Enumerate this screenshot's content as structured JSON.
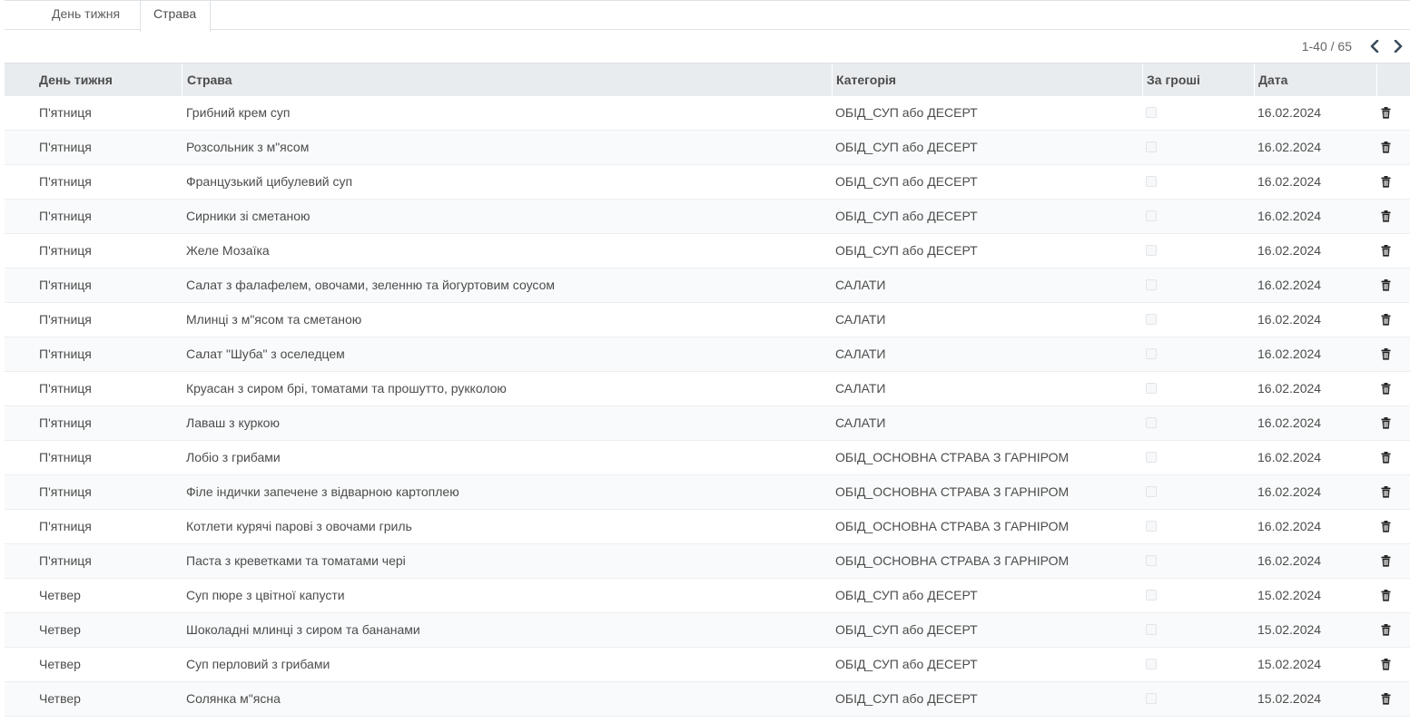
{
  "tabs": [
    {
      "label": "День тижня",
      "active": false
    },
    {
      "label": "Страва",
      "active": true
    }
  ],
  "pager": {
    "value": "1-40 / 65"
  },
  "colors": {
    "header_bg": "#e9ecef",
    "text": "#4c4c4c",
    "border": "#dee2e6"
  },
  "table": {
    "columns": {
      "day": "День тижня",
      "dish": "Страва",
      "category": "Категорія",
      "for_money": "За гроші",
      "date": "Дата"
    },
    "rows": [
      {
        "day": "П'ятниця",
        "dish": "Грибний крем суп",
        "category": "ОБІД_СУП або ДЕСЕРТ",
        "for_money": false,
        "date": "16.02.2024"
      },
      {
        "day": "П'ятниця",
        "dish": "Розсольник з м\"ясом",
        "category": "ОБІД_СУП або ДЕСЕРТ",
        "for_money": false,
        "date": "16.02.2024"
      },
      {
        "day": "П'ятниця",
        "dish": "Французький цибулевий суп",
        "category": "ОБІД_СУП або ДЕСЕРТ",
        "for_money": false,
        "date": "16.02.2024"
      },
      {
        "day": "П'ятниця",
        "dish": "Сирники зі сметаною",
        "category": "ОБІД_СУП або ДЕСЕРТ",
        "for_money": false,
        "date": "16.02.2024"
      },
      {
        "day": "П'ятниця",
        "dish": "Желе Мозаїка",
        "category": "ОБІД_СУП або ДЕСЕРТ",
        "for_money": false,
        "date": "16.02.2024"
      },
      {
        "day": "П'ятниця",
        "dish": "Салат з фалафелем, овочами, зеленню та йогуртовим соусом",
        "category": "САЛАТИ",
        "for_money": false,
        "date": "16.02.2024"
      },
      {
        "day": "П'ятниця",
        "dish": "Млинці з м\"ясом та сметаною",
        "category": "САЛАТИ",
        "for_money": false,
        "date": "16.02.2024"
      },
      {
        "day": "П'ятниця",
        "dish": "Салат \"Шуба\" з оселедцем",
        "category": "САЛАТИ",
        "for_money": false,
        "date": "16.02.2024"
      },
      {
        "day": "П'ятниця",
        "dish": "Круасан з сиром брі, томатами та прошутто, рукколою",
        "category": "САЛАТИ",
        "for_money": false,
        "date": "16.02.2024"
      },
      {
        "day": "П'ятниця",
        "dish": "Лаваш з куркою",
        "category": "САЛАТИ",
        "for_money": false,
        "date": "16.02.2024"
      },
      {
        "day": "П'ятниця",
        "dish": "Лобіо з грибами",
        "category": "ОБІД_ОСНОВНА СТРАВА З ГАРНІРОМ",
        "for_money": false,
        "date": "16.02.2024"
      },
      {
        "day": "П'ятниця",
        "dish": "Філе індички запечене з відварною картоплею",
        "category": "ОБІД_ОСНОВНА СТРАВА З ГАРНІРОМ",
        "for_money": false,
        "date": "16.02.2024"
      },
      {
        "day": "П'ятниця",
        "dish": "Котлети курячі парові з овочами гриль",
        "category": "ОБІД_ОСНОВНА СТРАВА З ГАРНІРОМ",
        "for_money": false,
        "date": "16.02.2024"
      },
      {
        "day": "П'ятниця",
        "dish": "Паста з креветками та томатами чері",
        "category": "ОБІД_ОСНОВНА СТРАВА З ГАРНІРОМ",
        "for_money": false,
        "date": "16.02.2024"
      },
      {
        "day": "Четвер",
        "dish": "Суп пюре з цвітної капусти",
        "category": "ОБІД_СУП або ДЕСЕРТ",
        "for_money": false,
        "date": "15.02.2024"
      },
      {
        "day": "Четвер",
        "dish": "Шоколадні млинці з сиром та бананами",
        "category": "ОБІД_СУП або ДЕСЕРТ",
        "for_money": false,
        "date": "15.02.2024"
      },
      {
        "day": "Четвер",
        "dish": "Суп перловий з грибами",
        "category": "ОБІД_СУП або ДЕСЕРТ",
        "for_money": false,
        "date": "15.02.2024"
      },
      {
        "day": "Четвер",
        "dish": "Солянка м\"ясна",
        "category": "ОБІД_СУП або ДЕСЕРТ",
        "for_money": false,
        "date": "15.02.2024"
      }
    ]
  }
}
